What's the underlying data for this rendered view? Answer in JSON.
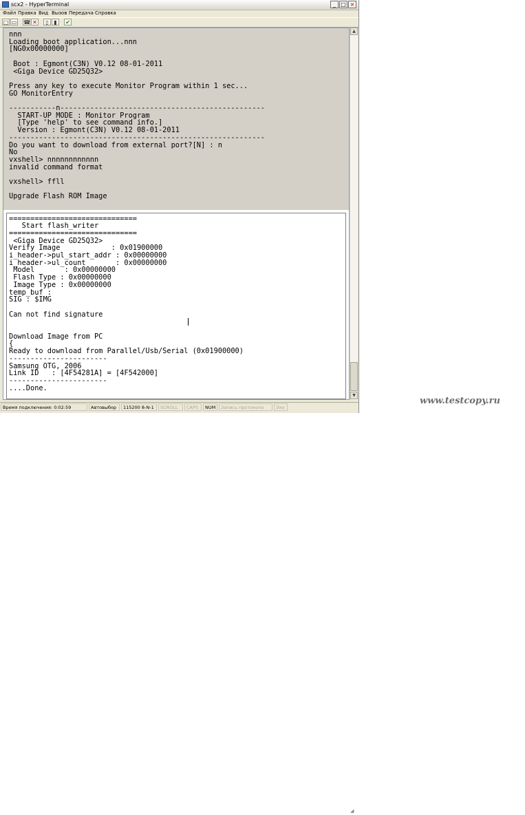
{
  "window": {
    "title": "scx2 - HyperTerminal",
    "controls": [
      "_",
      "□",
      "×"
    ]
  },
  "menu": [
    "Файл",
    "Правка",
    "Вид",
    "Вызов",
    "Передача",
    "Справка"
  ],
  "toolbar": {
    "buttons": [
      {
        "icon": "new-icon",
        "glyph": "□"
      },
      {
        "icon": "open-icon",
        "glyph": "▭"
      },
      {
        "icon": "call-icon",
        "glyph": "☎"
      },
      {
        "icon": "disconnect-icon",
        "glyph": "✕"
      },
      {
        "icon": "send-icon",
        "glyph": "▯"
      },
      {
        "icon": "receive-icon",
        "glyph": "▮"
      },
      {
        "icon": "properties-icon",
        "glyph": "✔"
      }
    ]
  },
  "terminal": {
    "lines": [
      "nnn",
      "Loading boot application...nnn",
      "[NG0x00000000]",
      "",
      " Boot : Egmont(C3N) V0.12 08-01-2011",
      " <Giga Device GD25Q32>",
      "",
      "Press any key to execute Monitor Program within 1 sec...",
      "GO MonitorEntry",
      "",
      "-----------n------------------------------------------------",
      "  START-UP MODE : Monitor Program",
      "  [Type 'help' to see command info.]",
      "  Version : Egmont(C3N) V0.12 08-01-2011",
      "------------------------------------------------------------",
      "Do you want to download from external port?[N] : n",
      "No",
      "vxshell> nnnnnnnnnnnn",
      "invalid command format",
      "",
      "vxshell> ffll",
      "",
      "Upgrade Flash ROM Image",
      "",
      "",
      "==============================",
      "   Start flash_writer",
      "==============================",
      " <Giga Device GD25Q32>",
      "Verify Image            : 0x01900000",
      "i_header->pul_start_addr : 0x00000000",
      "i_header->ul_count       : 0x00000000",
      " Model       : 0x00000000",
      " Flash Type : 0x00000000",
      " Image Type : 0x00000000",
      "temp_buf :",
      "SIG : $IMG",
      "",
      "Can not find signature",
      "",
      "",
      "Download Image from PC",
      "{",
      "Ready to download from Parallel/Usb/Serial (0x01900000)",
      "-----------------------",
      "Samsung OTG, 2006",
      "Link ID   : [4F54281A] = [4F542000]",
      "-----------------------",
      "....Done."
    ]
  },
  "status": [
    {
      "name": "connected-time",
      "text": "Время подключения: 0:02:59",
      "active": true
    },
    {
      "name": "autodetect",
      "text": "Автовыбор",
      "active": true
    },
    {
      "name": "port-settings",
      "text": "115200 8-N-1",
      "active": true
    },
    {
      "name": "scroll-indicator",
      "text": "SCROLL",
      "active": false
    },
    {
      "name": "caps-indicator",
      "text": "CAPS",
      "active": false
    },
    {
      "name": "num-indicator",
      "text": "NUM",
      "active": true
    },
    {
      "name": "log-indicator",
      "text": "Запись протокола",
      "active": false
    },
    {
      "name": "print-indicator",
      "text": "Эхо",
      "active": false
    }
  ],
  "watermark": "www.testcopy.ru"
}
